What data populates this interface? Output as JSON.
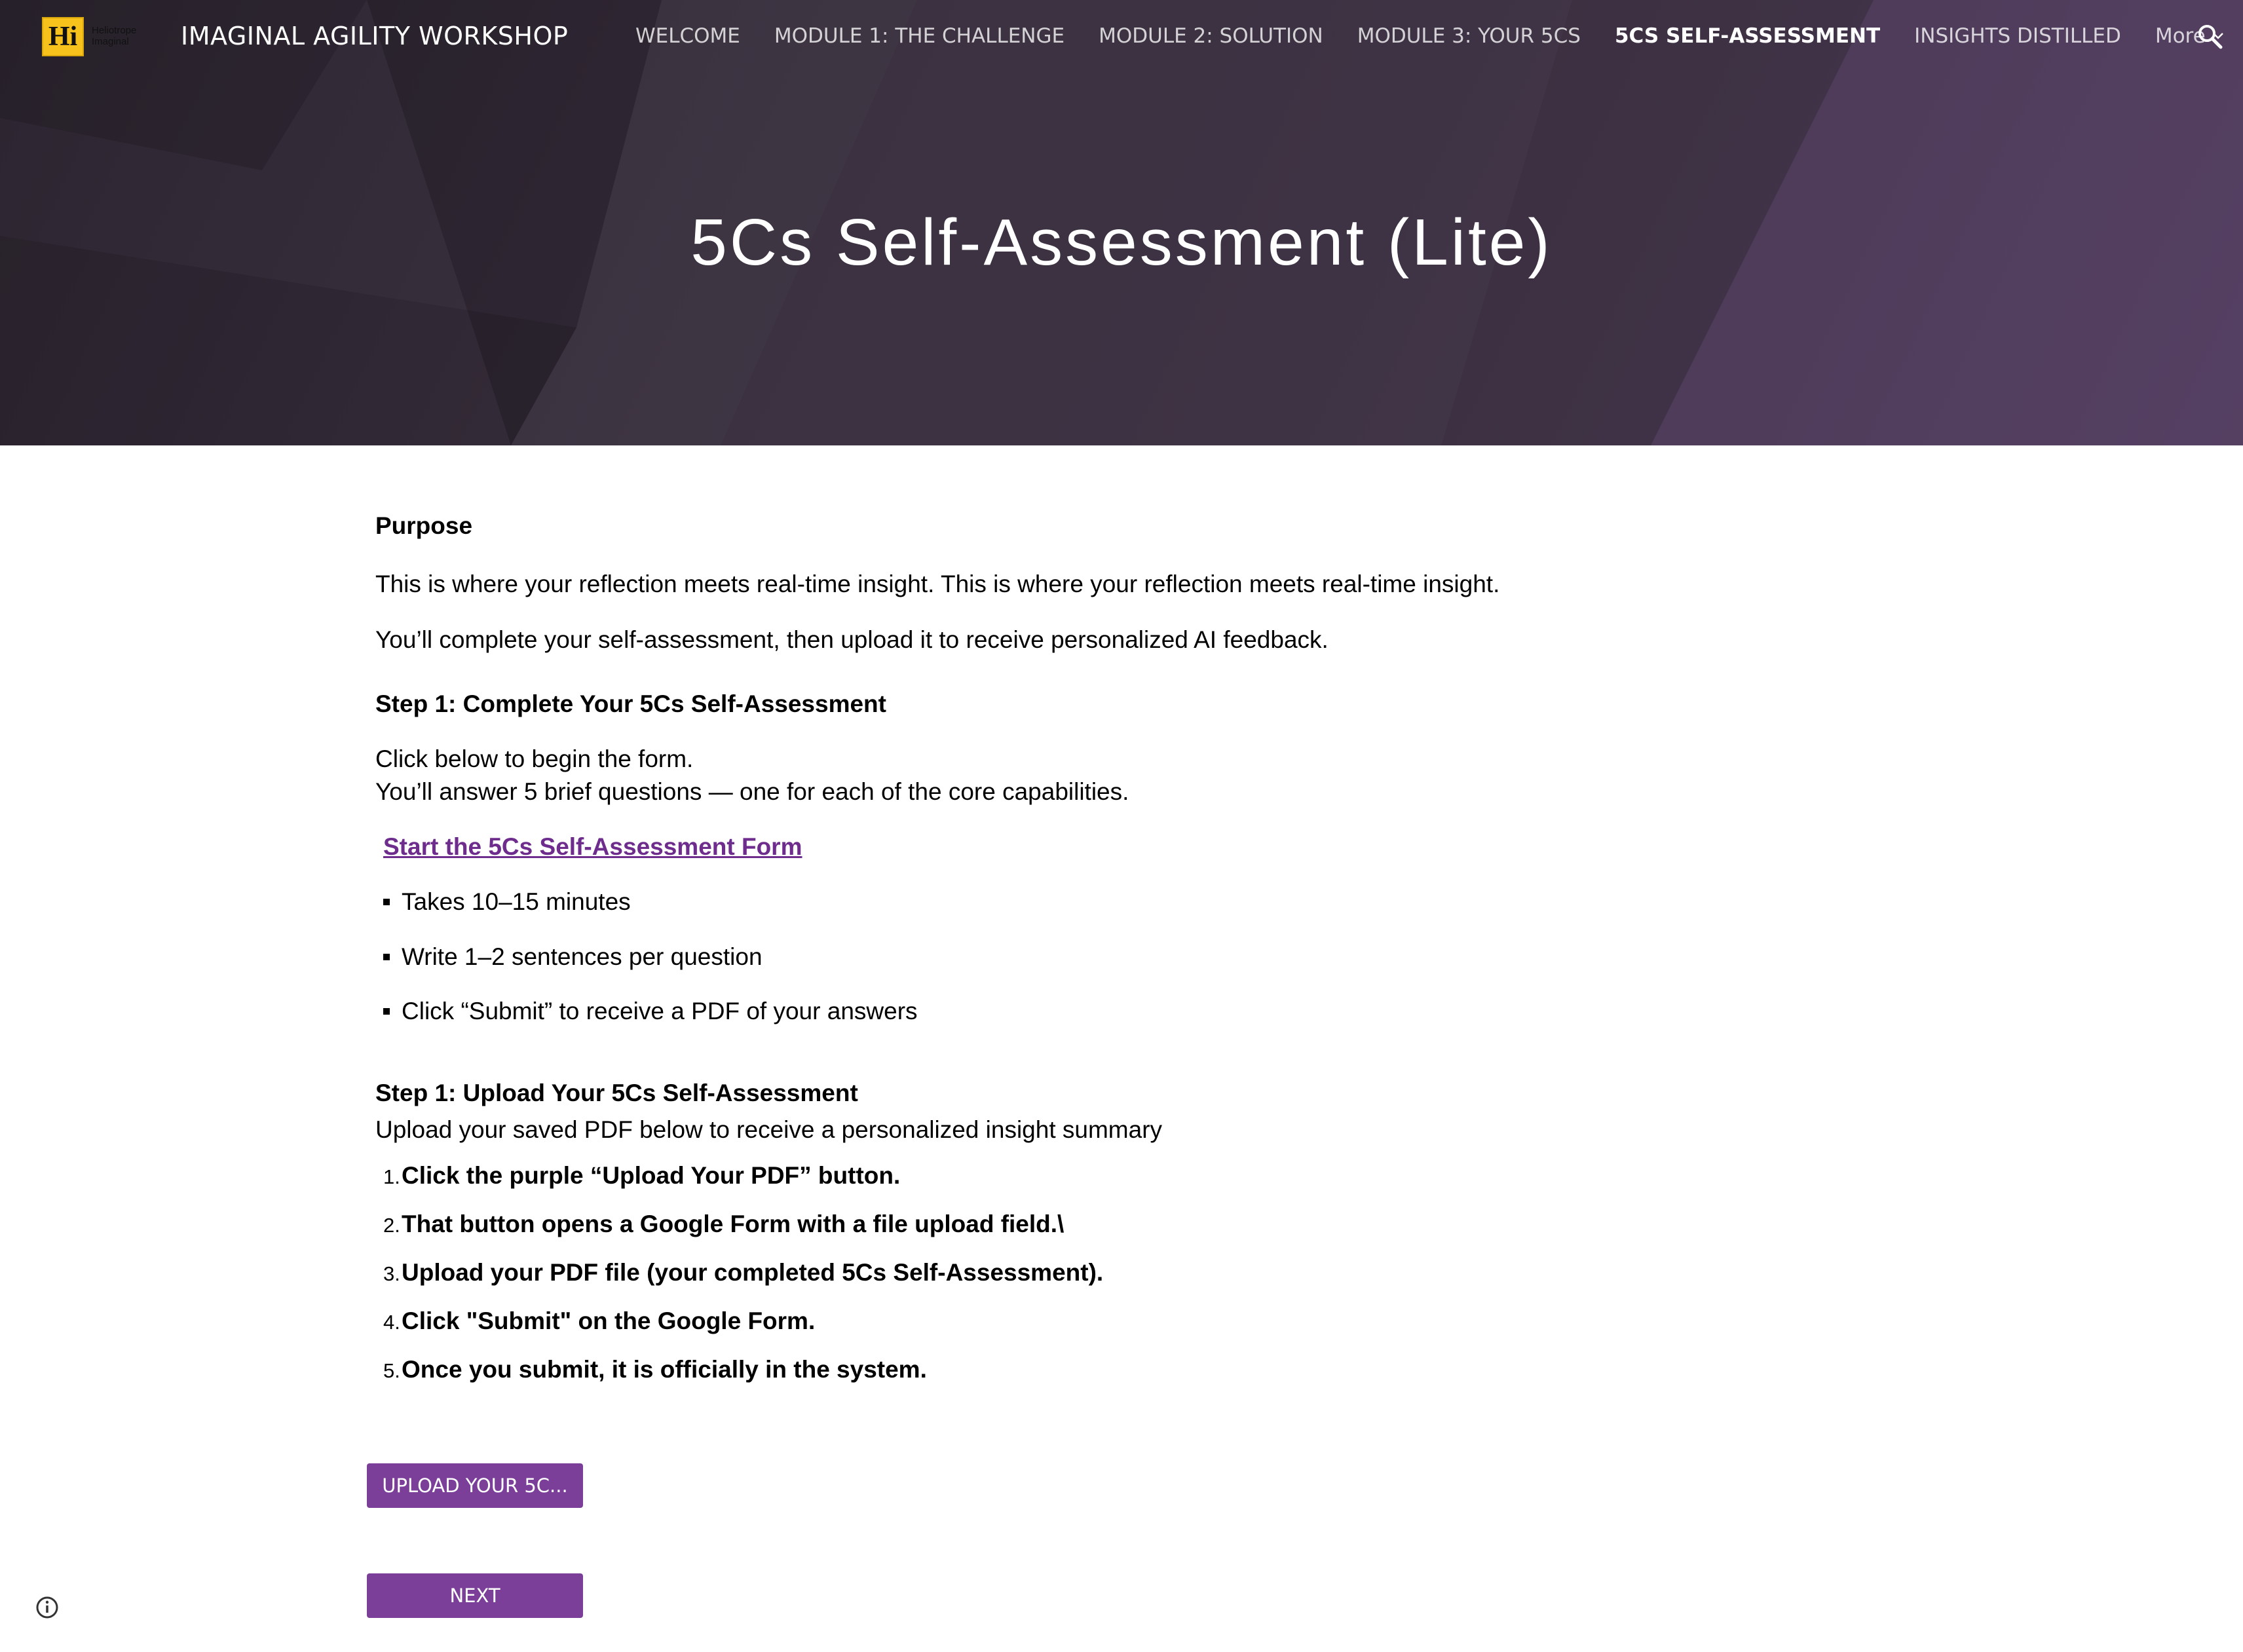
{
  "site": {
    "logo_text": "Hi",
    "logo_sub": [
      "Heliotrope",
      "Imaginal"
    ],
    "title": "IMAGINAL AGILITY WORKSHOP"
  },
  "nav": {
    "items": [
      {
        "label": "WELCOME"
      },
      {
        "label": "MODULE 1: THE CHALLENGE"
      },
      {
        "label": "MODULE 2: SOLUTION"
      },
      {
        "label": "MODULE 3: YOUR 5CS"
      },
      {
        "label": "5CS SELF-ASSESSMENT",
        "active": true
      },
      {
        "label": "INSIGHTS DISTILLED"
      }
    ],
    "more_label": "More"
  },
  "hero": {
    "title": "5Cs Self-Assessment (Lite)"
  },
  "content": {
    "purpose_heading": "Purpose",
    "purpose_text": "This is where your reflection meets real-time insight. This is where your reflection meets real-time insight.",
    "intro_text": "You’ll complete your self-assessment, then upload it to receive personalized AI feedback.",
    "step1_heading": "Step 1: Complete Your 5Cs Self-Assessment",
    "step1_line1": "Click below to begin the form.",
    "step1_line2": "You’ll answer 5 brief questions — one for each of the core capabilities.",
    "form_link": "Start the 5Cs Self-Assessment Form",
    "bullets": [
      "Takes 10–15 minutes",
      "Write 1–2 sentences per question",
      "Click “Submit” to receive a PDF of your answers"
    ],
    "step2_heading": "Step 1: Upload Your 5Cs Self-Assessment",
    "step2_text": "Upload your saved PDF below to receive a personalized insight summary",
    "steps": [
      {
        "num": "1.",
        "text": "Click the purple “Upload Your PDF” button."
      },
      {
        "num": "2.",
        "text": "That button opens a Google Form with a file upload field.\\"
      },
      {
        "num": "3.",
        "text": "Upload your PDF file (your completed 5Cs Self-Assessment)."
      },
      {
        "num": "4.",
        "text": "Click \"Submit\" on the Google Form."
      },
      {
        "num": "5.",
        "text": "Once you submit, it is officially in the system."
      }
    ]
  },
  "buttons": {
    "upload_label": "UPLOAD YOUR 5C...",
    "next_label": "NEXT"
  },
  "colors": {
    "accent": "#7b3f9a",
    "link": "#6e2c8d",
    "hero_dark": "#2c2530",
    "hero_light": "#4c3b57"
  },
  "icons": {
    "search": "search-icon",
    "more": "chevron-down-icon",
    "info": "info-icon"
  }
}
